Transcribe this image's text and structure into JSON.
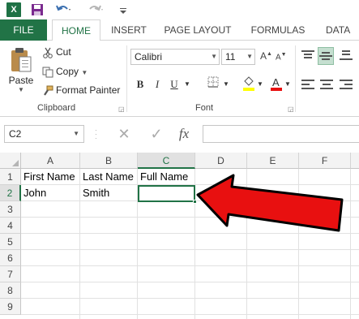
{
  "titlebar": {
    "app_icon_letter": "X",
    "icons": [
      "save-icon",
      "undo-icon",
      "redo-icon",
      "customize-qat-icon"
    ]
  },
  "tabs": {
    "file": "FILE",
    "home": "HOME",
    "insert": "INSERT",
    "page_layout": "PAGE LAYOUT",
    "formulas": "FORMULAS",
    "data": "DATA"
  },
  "clipboard": {
    "paste": "Paste",
    "cut": "Cut",
    "copy": "Copy",
    "format_painter": "Format Painter",
    "group_label": "Clipboard"
  },
  "font": {
    "font_name": "Calibri",
    "font_size": "11",
    "bold": "B",
    "italic": "I",
    "underline": "U",
    "group_label": "Font"
  },
  "formula_bar": {
    "name_box": "C2",
    "fx": "fx",
    "value": ""
  },
  "sheet": {
    "columns": [
      "A",
      "B",
      "C",
      "D",
      "E",
      "F"
    ],
    "rows": [
      "1",
      "2",
      "3",
      "4",
      "5",
      "6",
      "7",
      "8",
      "9"
    ],
    "cells": {
      "A1": "First Name",
      "B1": "Last Name",
      "C1": "Full Name",
      "A2": "John",
      "B2": "Smith"
    },
    "active_cell": "C2"
  },
  "colors": {
    "accent": "#217346",
    "arrow": "#e81010"
  }
}
